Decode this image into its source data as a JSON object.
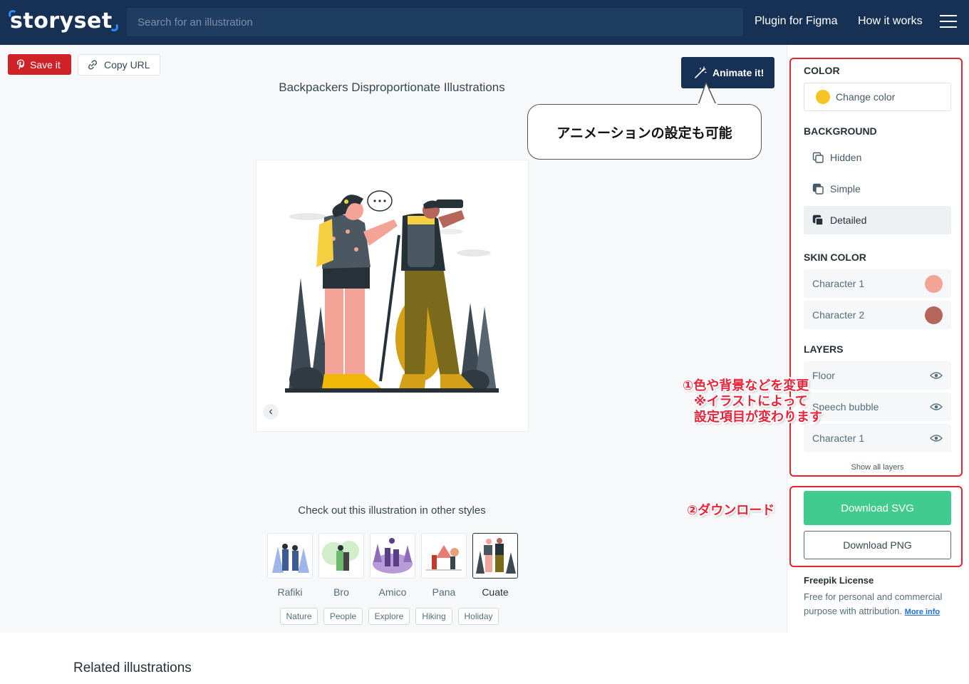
{
  "header": {
    "logo_text": "storyset",
    "search_placeholder": "Search for an illustration",
    "nav": [
      "Plugin for Figma",
      "How it works"
    ],
    "bg_color": "#173154"
  },
  "toolbar": {
    "save_label": "Save it",
    "copy_label": "Copy URL",
    "animate_label": "Animate it!"
  },
  "page": {
    "title": "Backpackers Disproportionate Illustrations",
    "callout": "アニメーションの設定も可能",
    "styles_title": "Check out this illustration in other styles",
    "styles": [
      {
        "label": "Rafiki",
        "active": false
      },
      {
        "label": "Bro",
        "active": false
      },
      {
        "label": "Amico",
        "active": false
      },
      {
        "label": "Pana",
        "active": false
      },
      {
        "label": "Cuate",
        "active": true
      }
    ],
    "tags": [
      "Nature",
      "People",
      "Explore",
      "Hiking",
      "Holiday"
    ],
    "related_title": "Related illustrations"
  },
  "sidebar": {
    "color_heading": "COLOR",
    "change_color_label": "Change color",
    "accent_color": "#f7c325",
    "background_heading": "BACKGROUND",
    "background_options": [
      {
        "label": "Hidden",
        "active": false
      },
      {
        "label": "Simple",
        "active": false
      },
      {
        "label": "Detailed",
        "active": true
      }
    ],
    "skin_heading": "SKIN COLOR",
    "skins": [
      {
        "label": "Character 1",
        "color": "#f4a496"
      },
      {
        "label": "Character 2",
        "color": "#b5655a"
      }
    ],
    "layers_heading": "LAYERS",
    "layers": [
      "Floor",
      "Speech bubble",
      "Character 1"
    ],
    "show_all": "Show all layers",
    "download_svg": "Download SVG",
    "download_png": "Download PNG",
    "license_title": "Freepik License",
    "license_text": "Free for personal and commercial purpose with attribution.",
    "license_link": "More info"
  },
  "annotations": {
    "note1_line1": "①色や背景などを変更",
    "note1_line2": "※イラストによって",
    "note1_line3": "設定項目が変わります",
    "note2": "②ダウンロード",
    "color": "#e6252c"
  }
}
